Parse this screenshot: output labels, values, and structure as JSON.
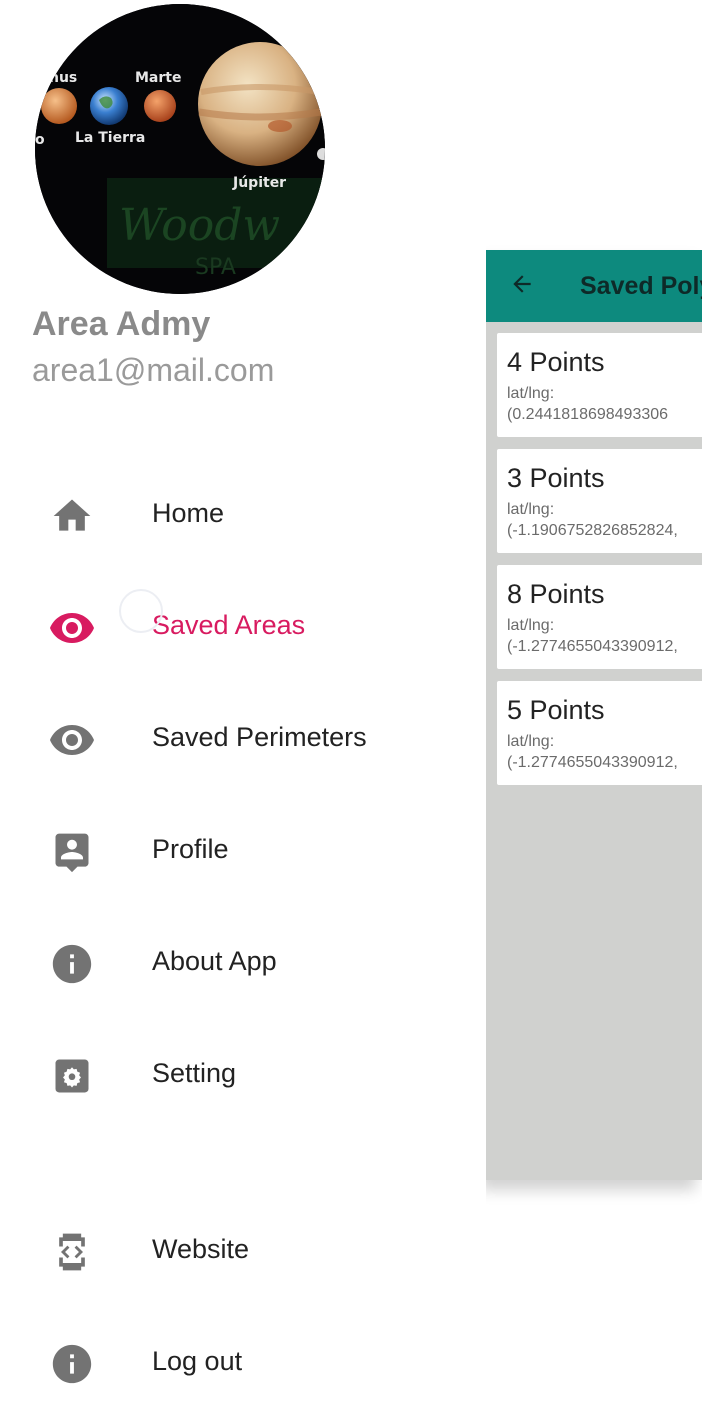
{
  "drawer": {
    "avatar_image": {
      "planet_labels": [
        "nus",
        "Marte",
        "La Tierra",
        "Júpiter",
        "o"
      ],
      "watermark_text": "Woodw",
      "watermark_sub": "SPA"
    },
    "user": {
      "name": "Area Admy",
      "email": "area1@mail.com"
    },
    "nav_items": [
      {
        "label": "Home",
        "icon": "home-icon",
        "active": false
      },
      {
        "label": "Saved Areas",
        "icon": "eye-icon",
        "active": true
      },
      {
        "label": "Saved Perimeters",
        "icon": "eye-icon",
        "active": false
      },
      {
        "label": "Profile",
        "icon": "contact-icon",
        "active": false
      },
      {
        "label": "About App",
        "icon": "info-icon",
        "active": false
      },
      {
        "label": "Setting",
        "icon": "settings-icon",
        "active": false
      },
      {
        "label": "Website",
        "icon": "code-device-icon",
        "active": false
      },
      {
        "label": "Log out",
        "icon": "info-icon",
        "active": false
      }
    ],
    "active_color": "#d81b60",
    "icon_color": "#737373"
  },
  "background_screen": {
    "toolbar": {
      "title": "Saved Poly",
      "back_icon": "arrow-back-icon",
      "color": "#0d8a7e"
    },
    "items": [
      {
        "points": "4 Points",
        "label": "lat/lng:",
        "value": "(0.2441818698493306"
      },
      {
        "points": "3 Points",
        "label": "lat/lng:",
        "value": "(-1.1906752826852824,"
      },
      {
        "points": "8 Points",
        "label": "lat/lng:",
        "value": "(-1.2774655043390912,"
      },
      {
        "points": "5 Points",
        "label": "lat/lng:",
        "value": "(-1.2774655043390912,"
      }
    ]
  }
}
